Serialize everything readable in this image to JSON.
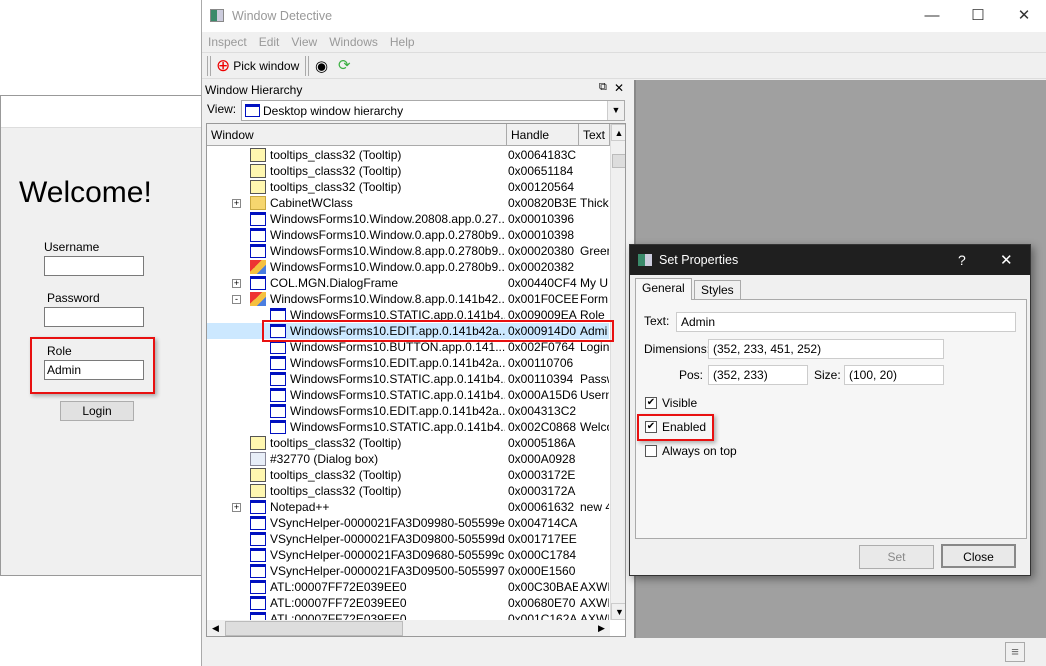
{
  "login_form": {
    "welcome": "Welcome!",
    "username_label": "Username",
    "username_value": "",
    "password_label": "Password",
    "password_value": "",
    "role_label": "Role",
    "role_value": "Admin",
    "login_button": "Login"
  },
  "app": {
    "title": "Window Detective",
    "menu": [
      "Inspect",
      "Edit",
      "View",
      "Windows",
      "Help"
    ],
    "toolbar": {
      "pick_window": "Pick window"
    }
  },
  "hierarchy": {
    "title": "Window Hierarchy",
    "view_label": "View:",
    "view_value": "Desktop window hierarchy",
    "columns": [
      "Window",
      "Handle",
      "Text"
    ],
    "rows": [
      {
        "depth": 1,
        "icon": "tooltip",
        "name": "tooltips_class32 (Tooltip)",
        "handle": "0x0064183C",
        "text": ""
      },
      {
        "depth": 1,
        "icon": "tooltip",
        "name": "tooltips_class32 (Tooltip)",
        "handle": "0x00651184",
        "text": ""
      },
      {
        "depth": 1,
        "icon": "tooltip",
        "name": "tooltips_class32 (Tooltip)",
        "handle": "0x00120564",
        "text": ""
      },
      {
        "depth": 1,
        "icon": "folder",
        "expander": "+",
        "name": "CabinetWClass",
        "handle": "0x00820B3E",
        "text": "Thick"
      },
      {
        "depth": 1,
        "icon": "window",
        "name": "WindowsForms10.Window.20808.app.0.27...",
        "handle": "0x00010396",
        "text": ""
      },
      {
        "depth": 1,
        "icon": "window",
        "name": "WindowsForms10.Window.0.app.0.2780b9...",
        "handle": "0x00010398",
        "text": ""
      },
      {
        "depth": 1,
        "icon": "window",
        "name": "WindowsForms10.Window.8.app.0.2780b9...",
        "handle": "0x00020380",
        "text": "Greer"
      },
      {
        "depth": 1,
        "icon": "form",
        "name": "WindowsForms10.Window.0.app.0.2780b9...",
        "handle": "0x00020382",
        "text": ""
      },
      {
        "depth": 1,
        "icon": "window",
        "expander": "+",
        "name": "COL.MGN.DialogFrame",
        "handle": "0x00440CF4",
        "text": "My U"
      },
      {
        "depth": 1,
        "icon": "form",
        "expander": "-",
        "name": "WindowsForms10.Window.8.app.0.141b42...",
        "handle": "0x001F0CEE",
        "text": "Form"
      },
      {
        "depth": 2,
        "icon": "window",
        "name": "WindowsForms10.STATIC.app.0.141b4...",
        "handle": "0x009009EA",
        "text": "Role"
      },
      {
        "depth": 2,
        "icon": "window",
        "name": "WindowsForms10.EDIT.app.0.141b42a...",
        "handle": "0x000914D0",
        "text": "Admi",
        "selected": true
      },
      {
        "depth": 2,
        "icon": "window",
        "name": "WindowsForms10.BUTTON.app.0.141...",
        "handle": "0x002F0764",
        "text": "Login"
      },
      {
        "depth": 2,
        "icon": "window",
        "name": "WindowsForms10.EDIT.app.0.141b42a...",
        "handle": "0x00110706",
        "text": ""
      },
      {
        "depth": 2,
        "icon": "window",
        "name": "WindowsForms10.STATIC.app.0.141b4...",
        "handle": "0x00110394",
        "text": "Passw"
      },
      {
        "depth": 2,
        "icon": "window",
        "name": "WindowsForms10.STATIC.app.0.141b4...",
        "handle": "0x000A15D6",
        "text": "Usern"
      },
      {
        "depth": 2,
        "icon": "window",
        "name": "WindowsForms10.EDIT.app.0.141b42a...",
        "handle": "0x004313C2",
        "text": ""
      },
      {
        "depth": 2,
        "icon": "window",
        "name": "WindowsForms10.STATIC.app.0.141b4...",
        "handle": "0x002C0868",
        "text": "Welco"
      },
      {
        "depth": 1,
        "icon": "tooltip",
        "name": "tooltips_class32 (Tooltip)",
        "handle": "0x0005186A",
        "text": ""
      },
      {
        "depth": 1,
        "icon": "dialog",
        "name": "#32770 (Dialog box)",
        "handle": "0x000A0928",
        "text": ""
      },
      {
        "depth": 1,
        "icon": "tooltip",
        "name": "tooltips_class32 (Tooltip)",
        "handle": "0x0003172E",
        "text": ""
      },
      {
        "depth": 1,
        "icon": "tooltip",
        "name": "tooltips_class32 (Tooltip)",
        "handle": "0x0003172A",
        "text": ""
      },
      {
        "depth": 1,
        "icon": "window",
        "expander": "+",
        "name": "Notepad++",
        "handle": "0x00061632",
        "text": "new 4"
      },
      {
        "depth": 1,
        "icon": "window",
        "name": "VSyncHelper-0000021FA3D09980-505599e...",
        "handle": "0x004714CA",
        "text": ""
      },
      {
        "depth": 1,
        "icon": "window",
        "name": "VSyncHelper-0000021FA3D09800-505599d...",
        "handle": "0x001717EE",
        "text": ""
      },
      {
        "depth": 1,
        "icon": "window",
        "name": "VSyncHelper-0000021FA3D09680-505599c...",
        "handle": "0x000C1784",
        "text": ""
      },
      {
        "depth": 1,
        "icon": "window",
        "name": "VSyncHelper-0000021FA3D09500-5055997...",
        "handle": "0x000E1560",
        "text": ""
      },
      {
        "depth": 1,
        "icon": "window",
        "name": "ATL:00007FF72E039EE0",
        "handle": "0x00C30BAE",
        "text": "AXWI"
      },
      {
        "depth": 1,
        "icon": "window",
        "name": "ATL:00007FF72E039EE0",
        "handle": "0x00680E70",
        "text": "AXWI"
      },
      {
        "depth": 1,
        "icon": "window",
        "name": "ATL:00007FF72E039EE0",
        "handle": "0x001C162A",
        "text": "AXWI"
      }
    ]
  },
  "dialog": {
    "title": "Set Properties",
    "help": "?",
    "tabs": [
      "General",
      "Styles"
    ],
    "text_label": "Text:",
    "text_value": "Admin",
    "dimensions_label": "Dimensions:",
    "dimensions_value": "(352, 233, 451, 252)",
    "pos_label": "Pos:",
    "pos_value": "(352, 233)",
    "size_label": "Size:",
    "size_value": "(100, 20)",
    "visible_label": "Visible",
    "visible": true,
    "enabled_label": "Enabled",
    "enabled": true,
    "always_on_top_label": "Always on top",
    "always_on_top": false,
    "set_button": "Set",
    "close_button": "Close"
  },
  "colors": {
    "highlight": "#e81010",
    "selection": "#cce8ff",
    "dialog_titlebar": "#1f1f1f",
    "mdi_background": "#a0a0a0"
  }
}
